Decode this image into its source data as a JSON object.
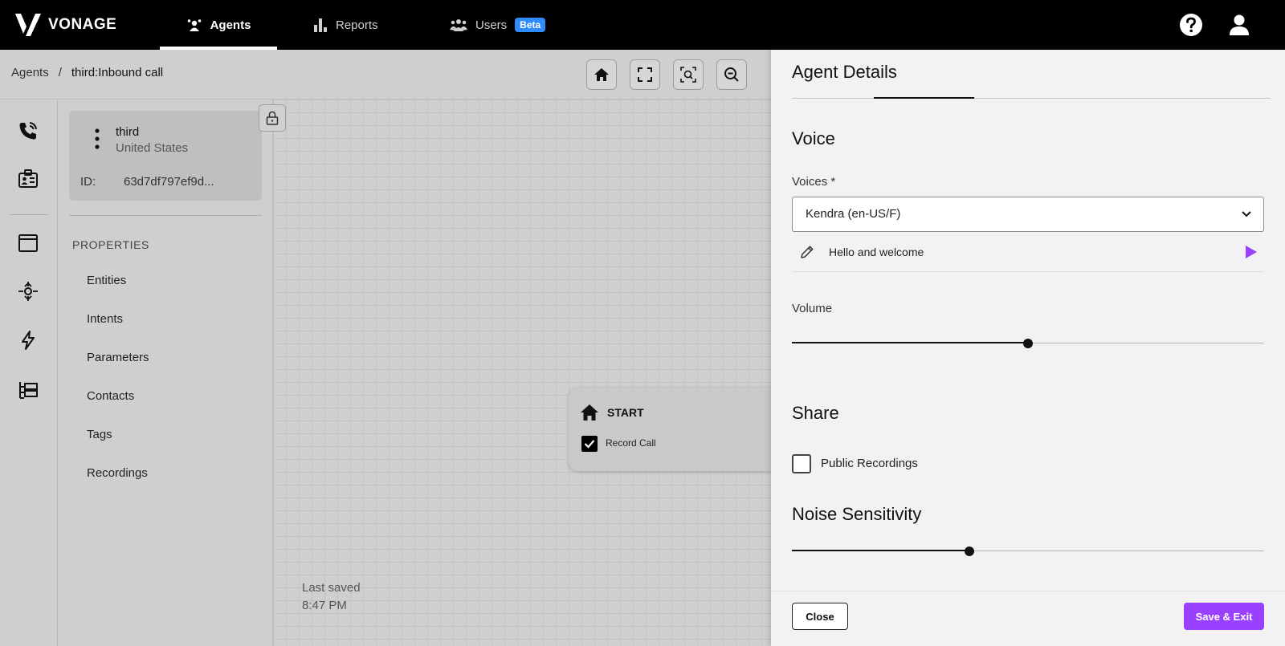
{
  "brand": {
    "name": "VONAGE"
  },
  "nav": {
    "agents": "Agents",
    "reports": "Reports",
    "users": "Users",
    "users_badge": "Beta"
  },
  "breadcrumb": {
    "root": "Agents",
    "separator": "/",
    "current": "third:Inbound call"
  },
  "agent": {
    "name": "third",
    "country": "United States",
    "id_label": "ID:",
    "id_value": "63d7df797ef9d..."
  },
  "properties": {
    "title": "PROPERTIES",
    "items": [
      "Entities",
      "Intents",
      "Parameters",
      "Contacts",
      "Tags",
      "Recordings"
    ]
  },
  "canvas": {
    "start_node": {
      "label": "START",
      "checkbox_label": "Record Call",
      "checked": true
    },
    "last_saved_label": "Last saved",
    "last_saved_time": "8:47 PM"
  },
  "drawer": {
    "title": "Agent Details",
    "voice": {
      "section_title": "Voice",
      "voices_label": "Voices *",
      "selected_voice": "Kendra (en-US/F)",
      "preview_text": "Hello and welcome"
    },
    "volume": {
      "label": "Volume",
      "value_fraction": 0.5
    },
    "share": {
      "section_title": "Share",
      "public_recordings_label": "Public Recordings",
      "public_recordings_checked": false
    },
    "noise": {
      "section_title": "Noise Sensitivity",
      "value_fraction": 0.375
    },
    "close_label": "Close",
    "save_label": "Save & Exit"
  },
  "colors": {
    "accent": "#9941ff",
    "beta_badge": "#2f8cff",
    "topbar": "#000000"
  },
  "icons": {
    "rail": [
      "phone-icon",
      "id-card-icon",
      "window-icon",
      "network-icon",
      "lightning-icon",
      "tree-icon"
    ],
    "top_right": [
      "help-icon",
      "user-icon"
    ],
    "tools": [
      "home-icon",
      "fullscreen-icon",
      "zoom-fit-icon",
      "zoom-out-icon"
    ]
  }
}
